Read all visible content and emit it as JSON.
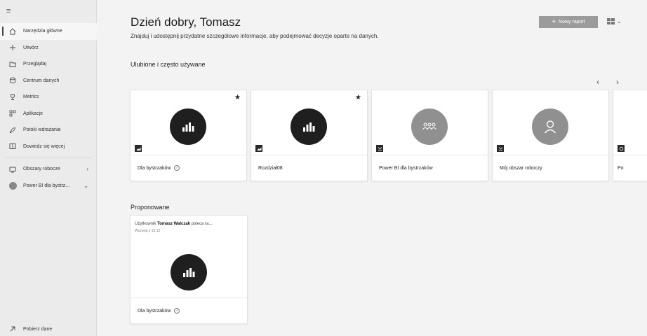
{
  "sidebar": {
    "items": [
      {
        "label": "Narzędzia główne",
        "icon": "home-icon"
      },
      {
        "label": "Utwórz",
        "icon": "plus-icon"
      },
      {
        "label": "Przeglądaj",
        "icon": "folder-icon"
      },
      {
        "label": "Centrum danych",
        "icon": "data-hub-icon"
      },
      {
        "label": "Metrics",
        "icon": "trophy-icon"
      },
      {
        "label": "Aplikacje",
        "icon": "apps-icon"
      },
      {
        "label": "Potoki wdrażania",
        "icon": "rocket-icon"
      },
      {
        "label": "Dowiedz się więcej",
        "icon": "book-icon"
      }
    ],
    "workspaces_label": "Obszary robocze",
    "current_workspace_label": "Power BI dla bystrz...",
    "get_data_label": "Pobierz dane"
  },
  "header": {
    "greeting": "Dzień dobry, Tomasz",
    "subtitle": "Znajduj i udostępnij przydatne szczegółowe informacje, aby podejmować decyzje oparte na danych.",
    "new_report_label": "Nowy raport"
  },
  "favorites": {
    "title": "Ulubione i często używane",
    "cards": [
      {
        "name": "Dla bystrzaków",
        "icon": "bar-chart-icon",
        "favorite": true
      },
      {
        "name": "Rozdział08",
        "icon": "bar-chart-icon",
        "favorite": true
      },
      {
        "name": "Power BI dla bystrzaków",
        "icon": "group-icon",
        "favorite": false
      },
      {
        "name": "Mój obszar roboczy",
        "icon": "person-icon",
        "favorite": false
      },
      {
        "name": "Po",
        "icon": "workspace-icon",
        "favorite": false
      }
    ]
  },
  "suggested": {
    "title": "Proponowane",
    "card": {
      "prefix": "Użytkownik",
      "user": "Tomasz Walczak",
      "suffix": "poleca ra...",
      "time": "Wczoraj o 15:12",
      "name": "Dla bystrzaków"
    }
  }
}
